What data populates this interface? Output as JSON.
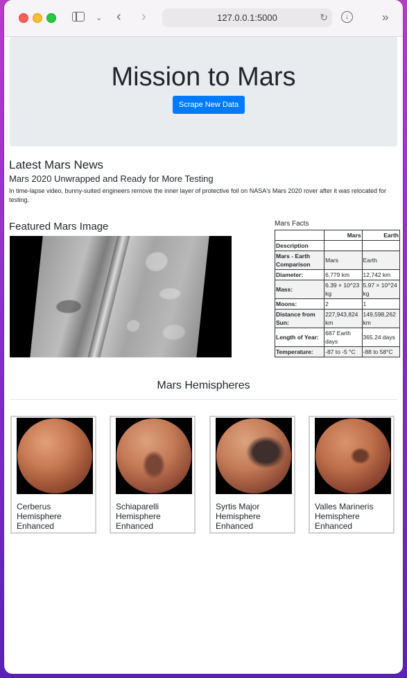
{
  "browser": {
    "url": "127.0.0.1:5000"
  },
  "jumbotron": {
    "title": "Mission to Mars",
    "button_label": "Scrape New Data"
  },
  "news": {
    "heading": "Latest Mars News",
    "title": "Mars 2020 Unwrapped and Ready for More Testing",
    "paragraph": "In time-lapse video, bunny-suited engineers remove the inner layer of protective foil on NASA's Mars 2020 rover after it was relocated for testing."
  },
  "featured": {
    "heading": "Featured Mars Image"
  },
  "facts": {
    "caption": "Mars Facts",
    "columns": [
      "",
      "Mars",
      "Earth"
    ],
    "index_name": "Description",
    "rows": [
      {
        "label": "Mars - Earth Comparison",
        "mars": "Mars",
        "earth": "Earth"
      },
      {
        "label": "Diameter:",
        "mars": "6,779 km",
        "earth": "12,742 km"
      },
      {
        "label": "Mass:",
        "mars": "6.39 × 10^23 kg",
        "earth": "5.97 × 10^24 kg"
      },
      {
        "label": "Moons:",
        "mars": "2",
        "earth": "1"
      },
      {
        "label": "Distance from Sun:",
        "mars": "227,943,824 km",
        "earth": "149,598,262 km"
      },
      {
        "label": "Length of Year:",
        "mars": "687 Earth days",
        "earth": "365.24 days"
      },
      {
        "label": "Temperature:",
        "mars": "-87 to -5 °C",
        "earth": "-88 to 58°C"
      }
    ]
  },
  "hemispheres": {
    "heading": "Mars Hemispheres",
    "items": [
      {
        "title": "Cerberus Hemisphere Enhanced"
      },
      {
        "title": "Schiaparelli Hemisphere Enhanced"
      },
      {
        "title": "Syrtis Major Hemisphere Enhanced"
      },
      {
        "title": "Valles Marineris Hemisphere Enhanced"
      }
    ]
  },
  "colors": {
    "primary_button": "#007bff",
    "jumbotron_bg": "#e9ecef"
  }
}
